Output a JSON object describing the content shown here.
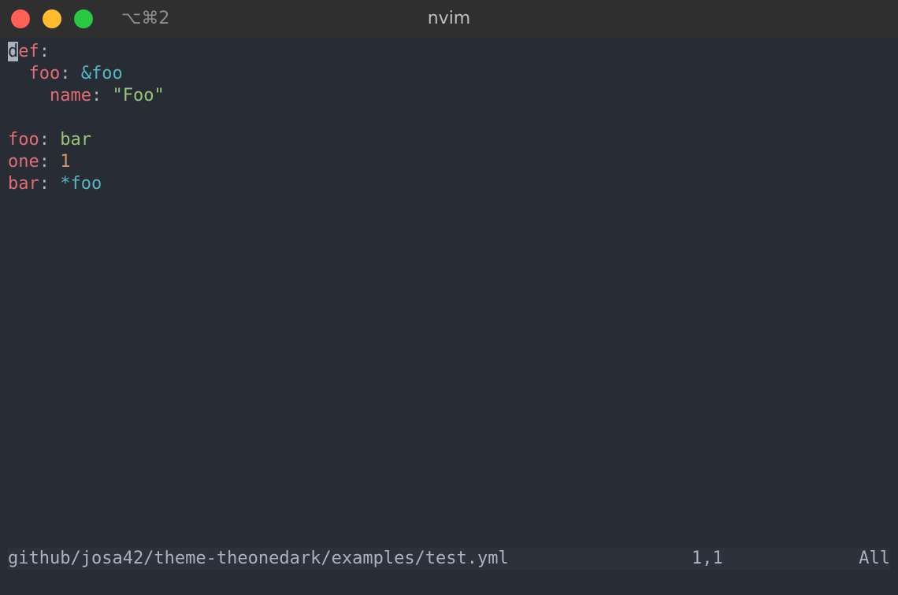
{
  "window": {
    "title": "nvim",
    "tab_shortcut": "⌥⌘2"
  },
  "colors": {
    "background": "#282c34",
    "titlebar": "#2f2f2f",
    "key": "#e06c75",
    "string": "#98c379",
    "number": "#d19a66",
    "anchor": "#56b6c2",
    "foreground": "#abb2bf"
  },
  "buffer": {
    "lines": [
      {
        "indent": "",
        "key": "def",
        "sep": ":",
        "value": "",
        "value_type": "none",
        "cursor_char": "d",
        "key_rest": "ef"
      },
      {
        "indent": "  ",
        "key": "foo",
        "sep": ": ",
        "value": "&foo",
        "value_type": "anchor"
      },
      {
        "indent": "    ",
        "key": "name",
        "sep": ": ",
        "value": "\"Foo\"",
        "value_type": "string"
      },
      {
        "indent": "",
        "key": "",
        "sep": "",
        "value": "",
        "value_type": "none"
      },
      {
        "indent": "",
        "key": "foo",
        "sep": ": ",
        "value": "bar",
        "value_type": "string"
      },
      {
        "indent": "",
        "key": "one",
        "sep": ": ",
        "value": "1",
        "value_type": "number"
      },
      {
        "indent": "",
        "key": "bar",
        "sep": ": ",
        "value": "*foo",
        "value_type": "anchor"
      }
    ]
  },
  "statusline": {
    "file_path": "github/josa42/theme-theonedark/examples/test.yml",
    "cursor_position": "1,1",
    "scroll_percent": "All"
  }
}
